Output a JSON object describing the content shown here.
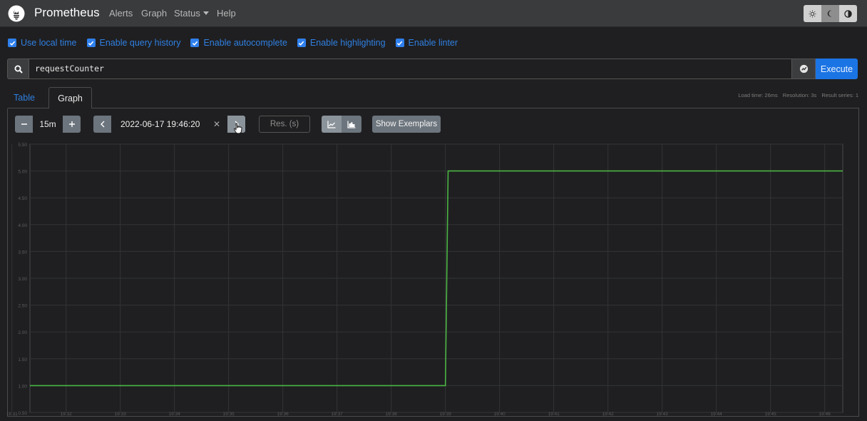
{
  "navbar": {
    "brand": "Prometheus",
    "links": [
      "Alerts",
      "Graph",
      "Status",
      "Help"
    ],
    "theme_buttons": [
      "sun-icon",
      "moon-icon",
      "contrast-icon"
    ],
    "colors": {
      "background": "#3a3b3d"
    }
  },
  "options": [
    {
      "label": "Use local time",
      "checked": true
    },
    {
      "label": "Enable query history",
      "checked": true
    },
    {
      "label": "Enable autocomplete",
      "checked": true
    },
    {
      "label": "Enable highlighting",
      "checked": true
    },
    {
      "label": "Enable linter",
      "checked": true
    }
  ],
  "query": {
    "expression": "requestCounter",
    "execute_label": "Execute"
  },
  "tabs": {
    "table": "Table",
    "graph": "Graph",
    "active": "Graph"
  },
  "stats": {
    "load_time": "Load time: 26ms",
    "resolution": "Resolution: 3s",
    "result_series": "Result series: 1"
  },
  "controls": {
    "range": "15m",
    "end_time": "2022-06-17 19:46:20",
    "resolution_placeholder": "Res. (s)",
    "show_exemplars": "Show Exemplars"
  },
  "chart_data": {
    "type": "line",
    "y_ticks": [
      "0.50",
      "1.00",
      "1.50",
      "2.00",
      "2.50",
      "3.00",
      "3.50",
      "4.00",
      "4.50",
      "5.00",
      "5.50"
    ],
    "ylim": [
      0.5,
      5.5
    ],
    "x_ticks": [
      "19:31",
      "19:32",
      "19:33",
      "19:34",
      "19:35",
      "19:36",
      "19:37",
      "19:38",
      "19:39",
      "19:40",
      "19:41",
      "19:42",
      "19:43",
      "19:44",
      "19:45",
      "19:46"
    ],
    "xlim": [
      "19:31:20",
      "19:46:20"
    ],
    "series": [
      {
        "points": [
          [
            "19:31:20",
            1
          ],
          [
            "19:39:00",
            1
          ],
          [
            "19:39:03",
            5
          ],
          [
            "19:46:20",
            5
          ]
        ],
        "color": "#4bb543"
      }
    ],
    "grid": true
  }
}
